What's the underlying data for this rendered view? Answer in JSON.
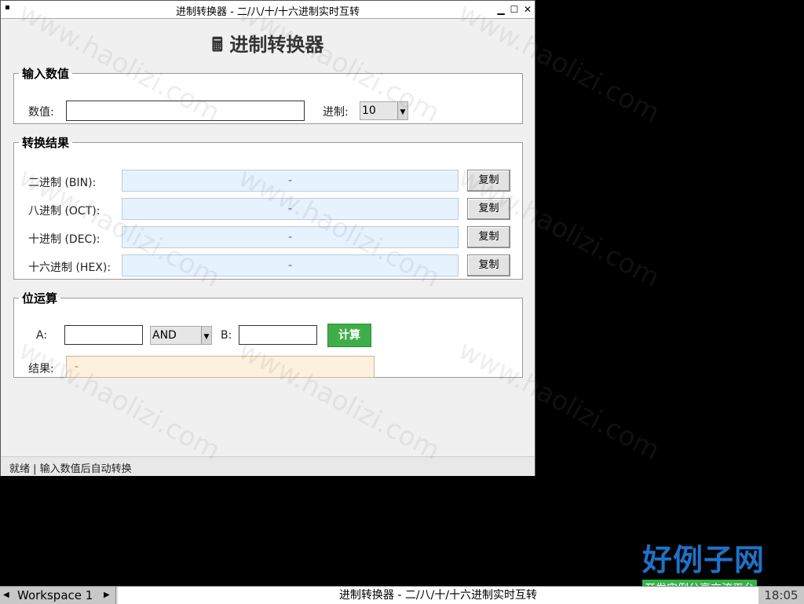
{
  "window": {
    "title": "进制转换器 - 二/八/十/十六进制实时互转",
    "heading": "🖩 进制转换器"
  },
  "input_section": {
    "legend": "输入数值",
    "value_label": "数值:",
    "value": "",
    "base_label": "进制:",
    "base_selected": "10"
  },
  "result_section": {
    "legend": "转换结果",
    "rows": [
      {
        "label": "二进制 (BIN):",
        "value": "-",
        "copy_label": "复制"
      },
      {
        "label": "八进制 (OCT):",
        "value": "-",
        "copy_label": "复制"
      },
      {
        "label": "十进制 (DEC):",
        "value": "-",
        "copy_label": "复制"
      },
      {
        "label": "十六进制 (HEX):",
        "value": "-",
        "copy_label": "复制"
      }
    ]
  },
  "bit_section": {
    "legend": "位运算",
    "a_label": "A:",
    "a_value": "",
    "operator_selected": "AND",
    "b_label": "B:",
    "b_value": "",
    "calc_label": "计算",
    "result_label": "结果:",
    "result_value": "-"
  },
  "statusbar": {
    "text": "就绪 | 输入数值后自动转换"
  },
  "taskbar": {
    "workspace": "Workspace 1",
    "task_title": "进制转换器 - 二/八/十/十六进制实时互转",
    "clock": "18:05"
  },
  "watermark": "www.haolizi.com",
  "logo": {
    "name": "好例子网",
    "slogan": "开发实例分享交流平台"
  },
  "colors": {
    "output_bg": "#e6f2fd",
    "calc_button": "#3fae49",
    "result_bg": "#fdf0de",
    "logo_blue": "#1e72c8"
  }
}
